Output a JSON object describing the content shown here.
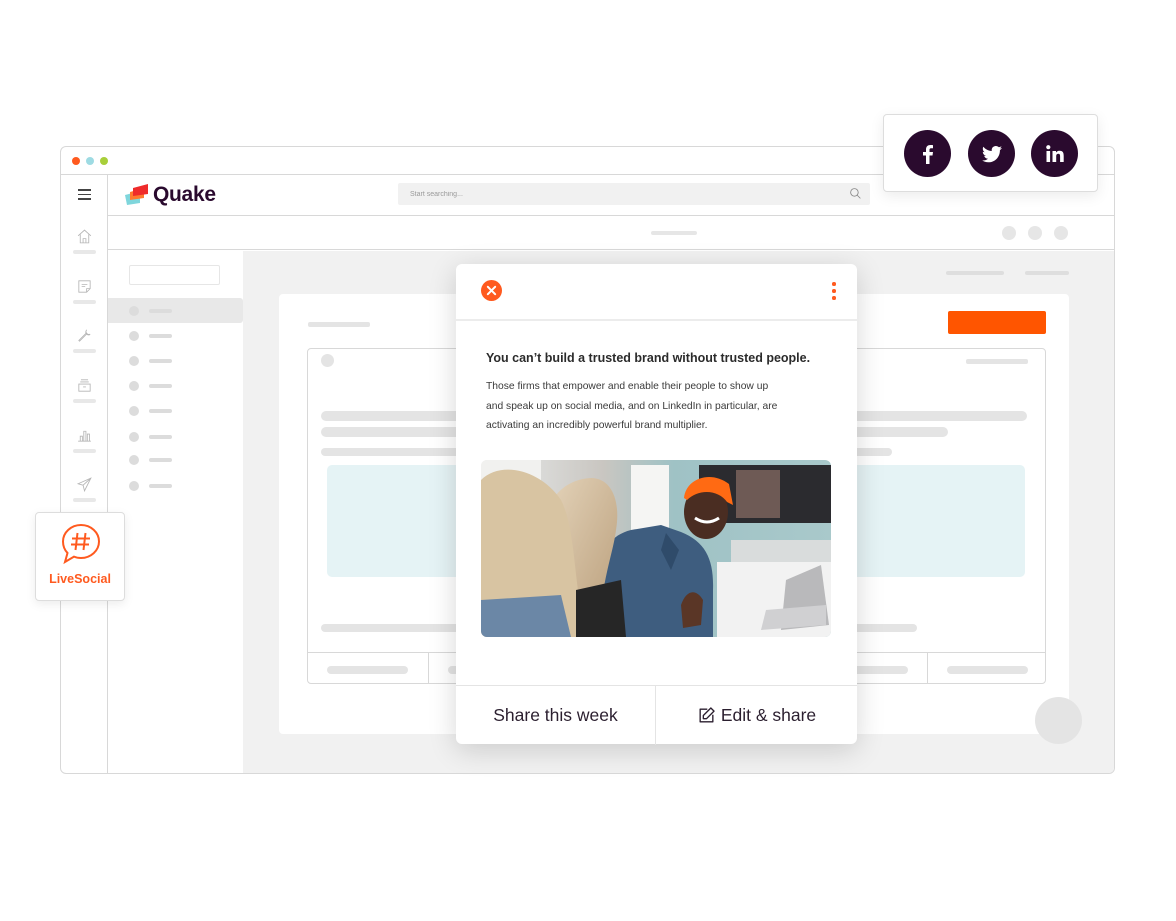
{
  "window": {
    "traffic_lights": [
      "close",
      "minimize",
      "maximize"
    ]
  },
  "header": {
    "logo_text": "Quake",
    "search": {
      "placeholder": "Start searching...",
      "value": ""
    }
  },
  "rail": {
    "menu_icon": "hamburger-icon",
    "items": [
      {
        "icon": "home-icon"
      },
      {
        "icon": "note-icon"
      },
      {
        "icon": "wrench-icon"
      },
      {
        "icon": "inbox-icon"
      },
      {
        "icon": "bar-chart-icon"
      },
      {
        "icon": "send-icon"
      }
    ]
  },
  "sidebar": {
    "item_count": 8,
    "active_index": 0
  },
  "social_share": {
    "networks": [
      {
        "name": "Facebook",
        "icon": "facebook-icon"
      },
      {
        "name": "Twitter",
        "icon": "twitter-icon"
      },
      {
        "name": "LinkedIn",
        "icon": "linkedin-icon"
      }
    ]
  },
  "livesocial_badge": {
    "label": "LiveSocial",
    "icon": "hashtag-chat-icon"
  },
  "popup": {
    "title": "You can’t build a trusted brand without trusted people.",
    "body_lines": [
      "Those firms that empower and enable their people to show up",
      "and speak up on social media, and on LinkedIn in particular, are",
      "activating an incredibly powerful brand multiplier."
    ],
    "image_alt": "Two colleagues chatting at a table, man in orange beanie smiling",
    "share_week_label": "Share this week",
    "edit_share_label": "Edit & share"
  },
  "colors": {
    "brand_orange": "#ff5a1f",
    "primary_button": "#ff5500",
    "logo_dark": "#2a0a2e",
    "social_circle": "#2a0a2e",
    "media_placeholder": "#e5f3f5"
  }
}
